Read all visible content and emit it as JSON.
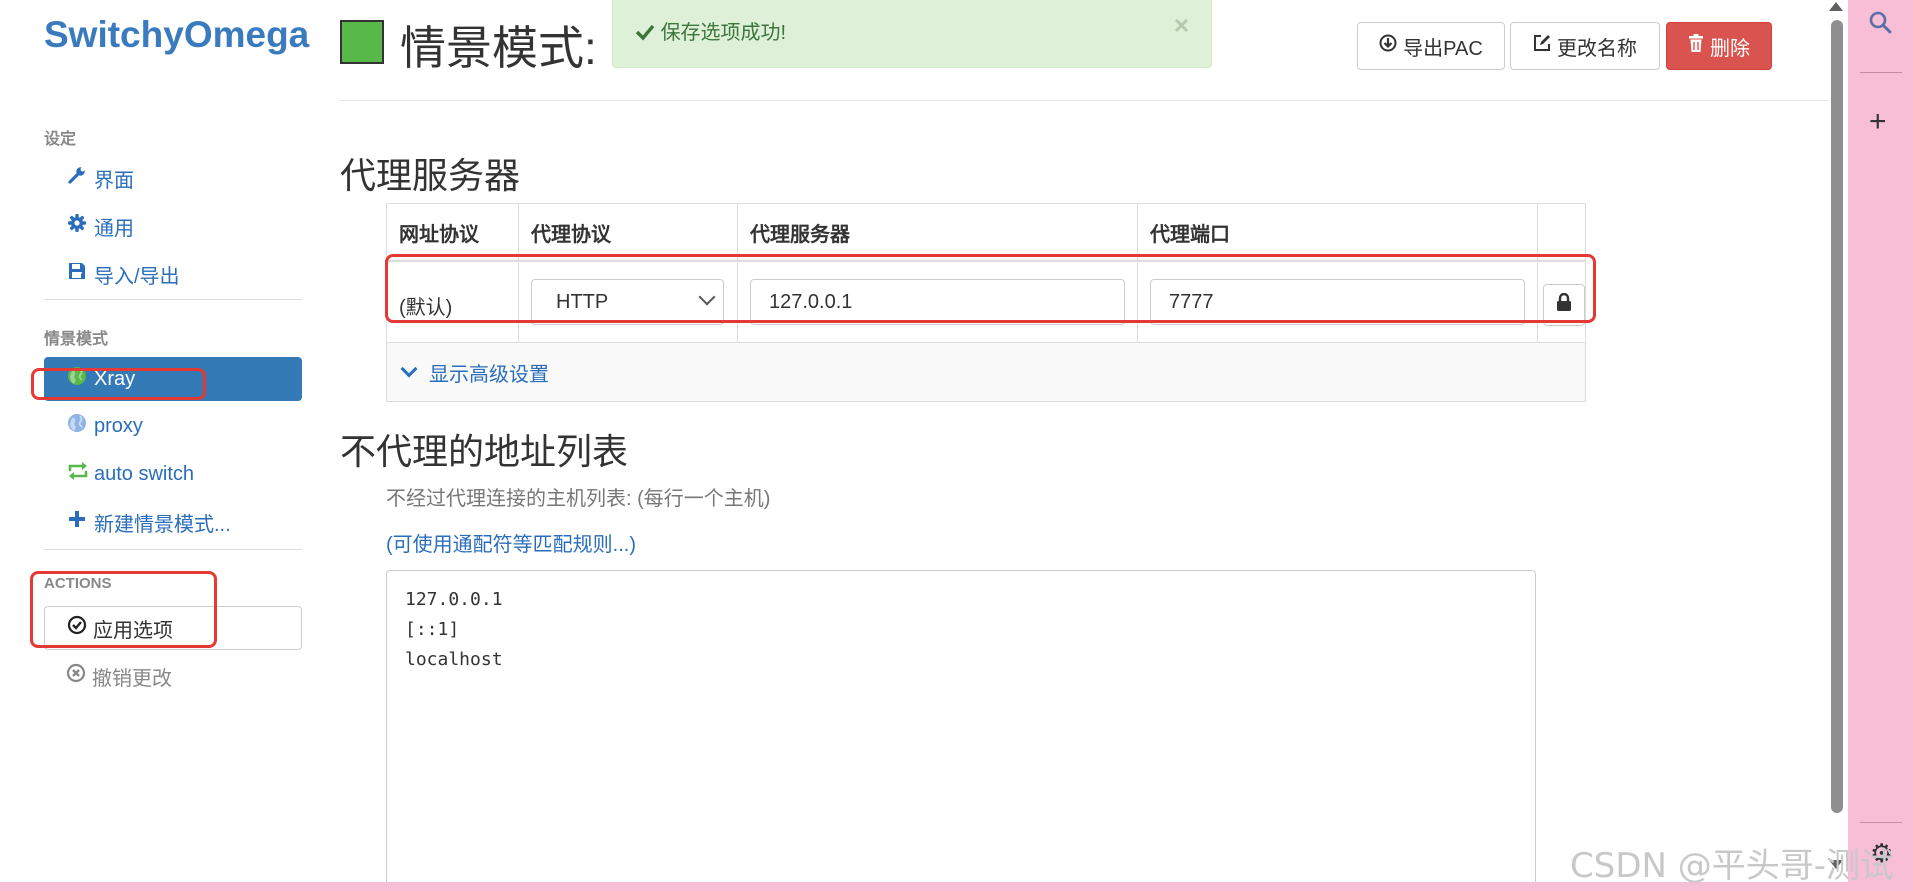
{
  "app": {
    "brand": "SwitchyOmega"
  },
  "sidebar": {
    "settings_header": "设定",
    "settings_items": [
      {
        "label": "界面",
        "icon": "wrench-icon"
      },
      {
        "label": "通用",
        "icon": "gear-icon"
      },
      {
        "label": "导入/导出",
        "icon": "save-icon"
      }
    ],
    "profiles_header": "情景模式",
    "profiles": [
      {
        "label": "Xray",
        "icon": "globe-icon",
        "active": true
      },
      {
        "label": "proxy",
        "icon": "globe-icon",
        "active": false
      },
      {
        "label": "auto switch",
        "icon": "switch-arrows-icon",
        "active": false
      },
      {
        "label": "新建情景模式...",
        "icon": "plus-icon",
        "active": false
      }
    ],
    "actions_header": "ACTIONS",
    "apply_label": "应用选项",
    "discard_label": "撤销更改"
  },
  "header": {
    "title": "情景模式:",
    "color": "#58b84a",
    "alert_text": "保存选项成功!",
    "export_pac": "导出PAC",
    "rename": "更改名称",
    "delete": "删除"
  },
  "proxy_section": {
    "title": "代理服务器",
    "columns": [
      "网址协议",
      "代理协议",
      "代理服务器",
      "代理端口"
    ],
    "row": {
      "scheme": "(默认)",
      "protocol": "HTTP",
      "server": "127.0.0.1",
      "port": "7777"
    },
    "advanced_label": "显示高级设置"
  },
  "bypass_section": {
    "title": "不代理的地址列表",
    "help_text": "不经过代理连接的主机列表: (每行一个主机)",
    "help_link": "(可使用通配符等匹配规则...)",
    "lines": [
      "127.0.0.1",
      "[::1]",
      "localhost"
    ]
  },
  "watermark": "CSDN @平头哥-测试"
}
